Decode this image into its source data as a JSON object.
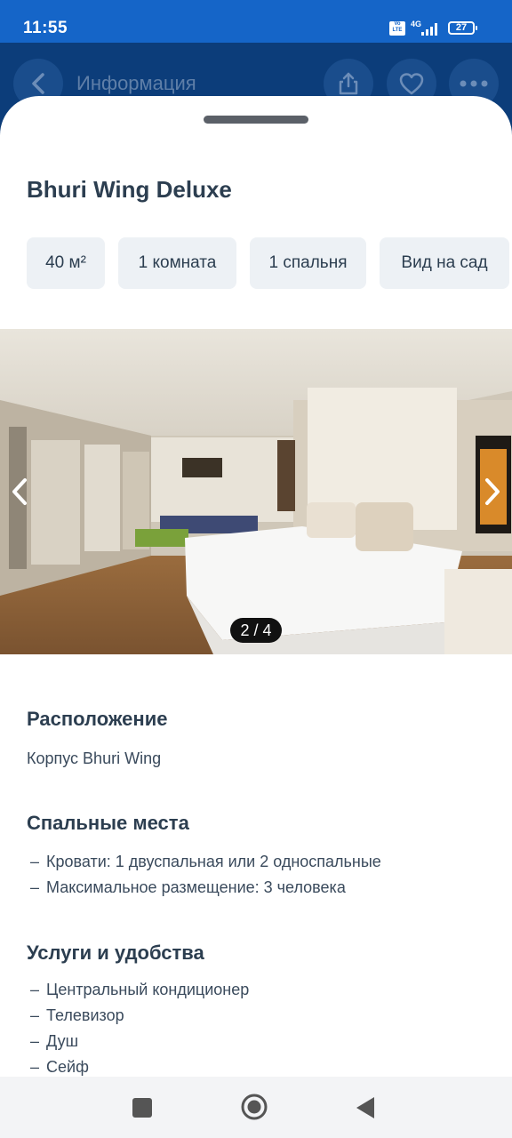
{
  "status_bar": {
    "time": "11:55",
    "volte": "Vo LTE",
    "network": "4G",
    "battery": "27"
  },
  "app_bar": {
    "title": "Информация"
  },
  "room": {
    "title": "Bhuri Wing Deluxe",
    "chips": [
      "40 м²",
      "1 комната",
      "1 спальня",
      "Вид на сад"
    ]
  },
  "gallery": {
    "counter": "2 / 4"
  },
  "sections": {
    "location": {
      "title": "Расположение",
      "text": "Корпус Bhuri Wing"
    },
    "beds": {
      "title": "Спальные места",
      "items": [
        "Кровати: 1 двуспальная или 2 односпальные",
        "Максимальное размещение: 3 человека"
      ]
    },
    "amenities": {
      "title": "Услуги и удобства",
      "items": [
        "Центральный кондиционер",
        "Телевизор",
        "Душ",
        "Сейф"
      ]
    }
  },
  "colors": {
    "status_bar": "#1565c8",
    "app_bar": "#0c3d7a",
    "text": "#2c3e50",
    "chip_bg": "#edf1f5"
  }
}
